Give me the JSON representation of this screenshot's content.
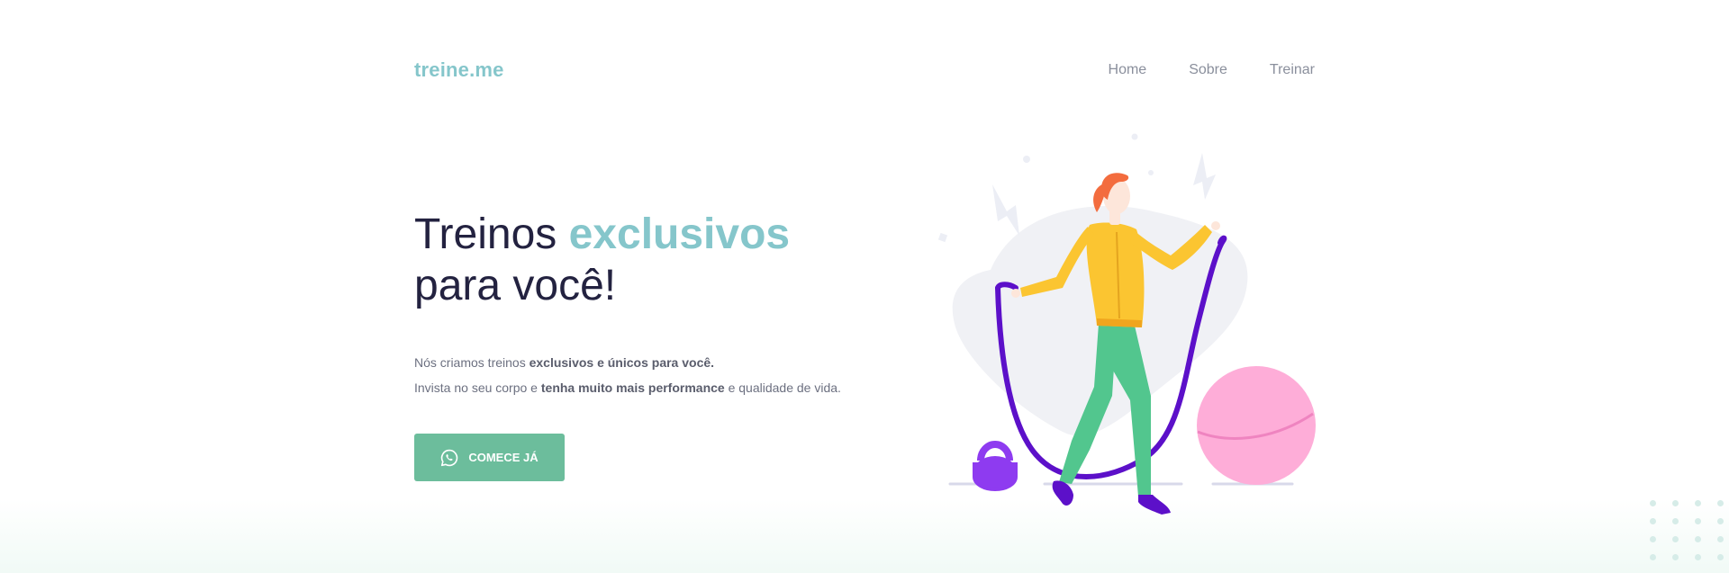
{
  "header": {
    "logo": "treine.me",
    "nav": [
      {
        "label": "Home"
      },
      {
        "label": "Sobre"
      },
      {
        "label": "Treinar"
      }
    ]
  },
  "hero": {
    "title_part1": "Treinos ",
    "title_accent": "exclusivos",
    "title_line2": "para você!",
    "desc_line1": {
      "plain": "Nós criamos treinos ",
      "bold": "exclusivos e únicos para você."
    },
    "desc_line2": {
      "plain1": "Invista no seu corpo e ",
      "bold": "tenha muito mais performance",
      "plain2": " e qualidade de vida."
    },
    "cta_label": "COMECE JÁ",
    "cta_icon": "whatsapp-icon"
  },
  "colors": {
    "accent": "#85c6cb",
    "heading": "#232240",
    "button": "#6cbd9c",
    "nav_text": "#8a8f9c"
  }
}
